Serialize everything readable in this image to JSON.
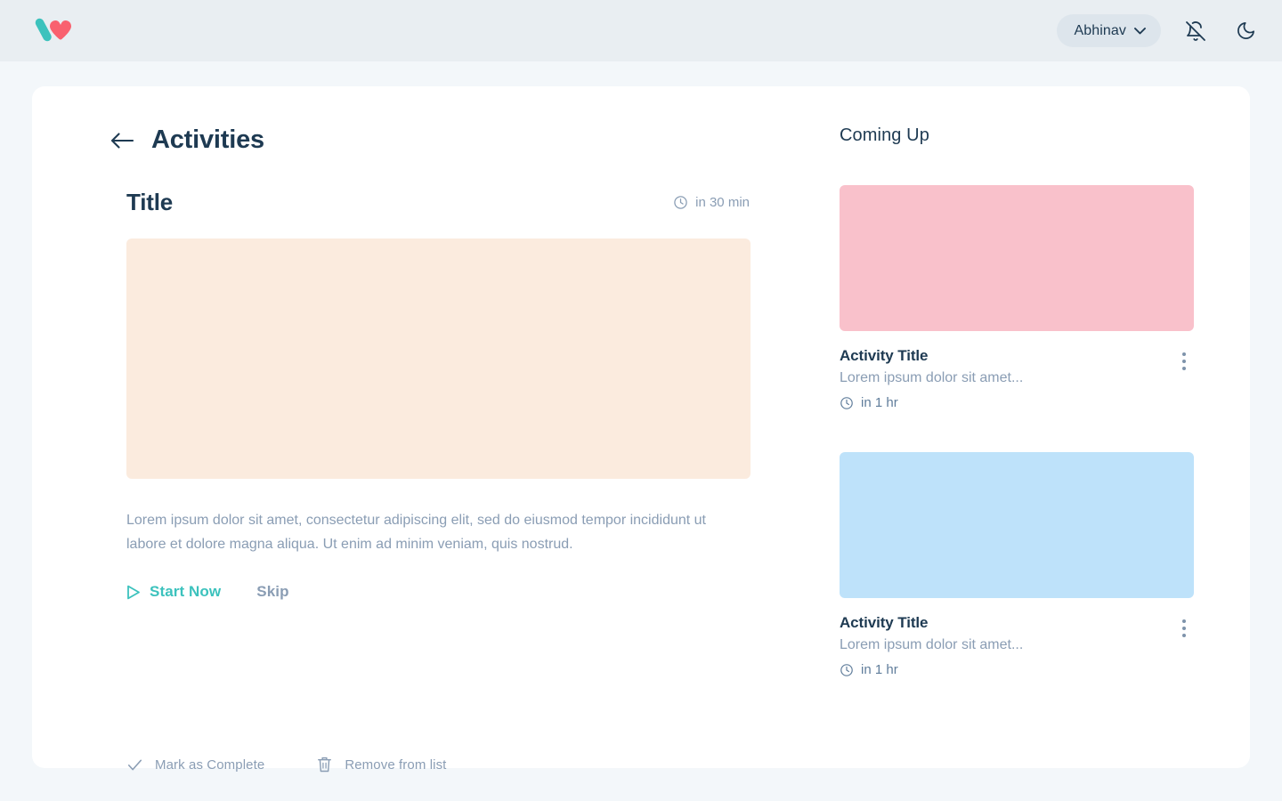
{
  "topbar": {
    "logo_name": "wellness-logo",
    "logo_colors": {
      "teal": "#3cc2bd",
      "pink": "#f9616f"
    },
    "user": {
      "name": "Abhinav",
      "chevron_icon": "chevron-down-icon"
    },
    "notifications_icon": "bell-off-icon",
    "theme_icon": "moon-icon"
  },
  "main": {
    "back_icon": "arrow-left-icon",
    "page_title": "Activities",
    "detail": {
      "title": "Title",
      "time_icon": "clock-icon",
      "time_label": "in 30 min",
      "hero_color": "#fbebde",
      "description": "Lorem ipsum dolor sit amet, consectetur adipiscing elit, sed do eiusmod tempor incididunt ut labore et dolore magna aliqua. Ut enim ad minim veniam, quis nostrud.",
      "start_icon": "play-icon",
      "start_label": "Start Now",
      "skip_label": "Skip"
    },
    "bottom_actions": [
      {
        "icon": "check-icon",
        "label": "Mark as Complete"
      },
      {
        "icon": "trash-icon",
        "label": "Remove from list"
      }
    ]
  },
  "coming_up": {
    "heading": "Coming Up",
    "items": [
      {
        "thumb_color": "#f9c1cb",
        "title": "Activity Title",
        "subtitle": "Lorem ipsum dolor sit amet...",
        "time_icon": "clock-icon",
        "time_label": "in 1 hr",
        "menu_icon": "kebab-menu-icon"
      },
      {
        "thumb_color": "#bee2fa",
        "title": "Activity Title",
        "subtitle": "Lorem ipsum dolor sit amet...",
        "time_icon": "clock-icon",
        "time_label": "in 1 hr",
        "menu_icon": "kebab-menu-icon"
      }
    ]
  },
  "theme": {
    "page_bg": "#f3f7fa",
    "topbar_bg": "#e9eef2",
    "card_bg": "#ffffff",
    "accent_teal": "#3cc2bd",
    "accent_pink": "#f9616f",
    "text_primary": "#1e3a52",
    "text_muted": "#8a9db4"
  }
}
